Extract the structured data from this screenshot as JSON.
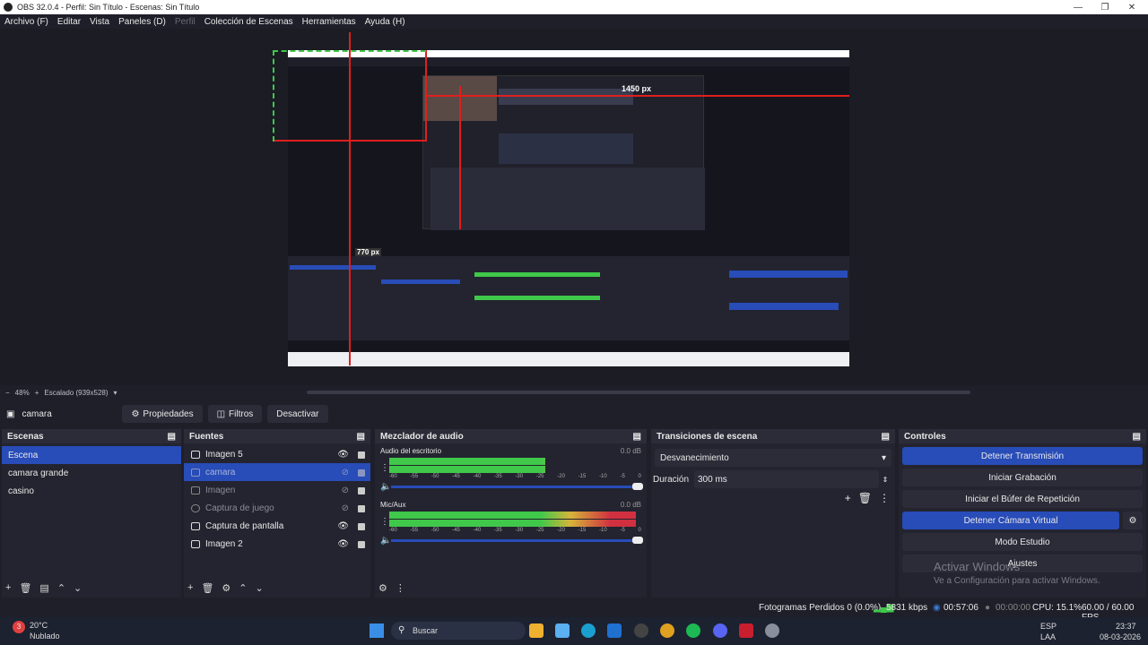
{
  "window": {
    "title": "OBS 32.0.4 - Perfil: Sin Título - Escenas: Sin Título"
  },
  "menu": [
    {
      "label": "Archivo (F)",
      "dim": false
    },
    {
      "label": "Editar",
      "dim": false
    },
    {
      "label": "Vista",
      "dim": false
    },
    {
      "label": "Paneles (D)",
      "dim": false
    },
    {
      "label": "Perfil",
      "dim": true
    },
    {
      "label": "Colección de Escenas",
      "dim": false
    },
    {
      "label": "Herramientas",
      "dim": false
    },
    {
      "label": "Ayuda (H)",
      "dim": false
    }
  ],
  "preview": {
    "px_top": "1450 px",
    "px_left": "770 px",
    "zoom": "48%",
    "scale_label": "Escalado (939x528)"
  },
  "source_bar": {
    "current": "camara",
    "properties": "Propiedades",
    "filters": "Filtros",
    "disable": "Desactivar"
  },
  "scenes": {
    "title": "Escenas",
    "items": [
      "Escena",
      "camara grande",
      "casino"
    ],
    "selected": 0
  },
  "sources": {
    "title": "Fuentes",
    "items": [
      {
        "label": "Imagen 5",
        "visible": true,
        "dim": false,
        "icon": "image-icon"
      },
      {
        "label": "camara",
        "visible": false,
        "dim": true,
        "icon": "camera-icon"
      },
      {
        "label": "Imagen",
        "visible": false,
        "dim": true,
        "icon": "image-icon"
      },
      {
        "label": "Captura de juego",
        "visible": false,
        "dim": true,
        "icon": "gamepad-icon"
      },
      {
        "label": "Captura de pantalla",
        "visible": true,
        "dim": false,
        "icon": "monitor-icon"
      },
      {
        "label": "Imagen 2",
        "visible": true,
        "dim": false,
        "icon": "image-icon"
      }
    ],
    "selected": 1
  },
  "mixer": {
    "title": "Mezclador de audio",
    "channels": [
      {
        "name": "Audio del escritorio",
        "db": "0.0 dB",
        "level": 0.62
      },
      {
        "name": "Mic/Aux",
        "db": "0.0 dB",
        "level": 0.98
      }
    ],
    "ticks": [
      "-60",
      "-55",
      "-50",
      "-45",
      "-40",
      "-35",
      "-30",
      "-25",
      "-20",
      "-15",
      "-10",
      "-5",
      "0"
    ]
  },
  "transitions": {
    "title": "Transiciones de escena",
    "selected": "Desvanecimiento",
    "duration_label": "Duración",
    "duration_value": "300 ms"
  },
  "controls": {
    "title": "Controles",
    "buttons": [
      {
        "label": "Detener Transmisión",
        "active": true
      },
      {
        "label": "Iniciar Grabación",
        "active": false
      },
      {
        "label": "Iniciar el Búfer de Repetición",
        "active": false
      },
      {
        "label": "Detener Cámara Virtual",
        "active": true
      },
      {
        "label": "Modo Estudio",
        "active": false
      },
      {
        "label": "Ajustes",
        "active": false
      }
    ],
    "watermark_title": "Activar Windows",
    "watermark_sub": "Ve a Configuración para activar Windows."
  },
  "status": {
    "dropped": "Fotogramas Perdidos 0 (0.0%)",
    "bitrate": "5831 kbps",
    "stream_time": "00:57:06",
    "rec_time": "00:00:00",
    "cpu": "CPU: 15.1%",
    "fps": "60.00 / 60.00 FPS"
  },
  "taskbar": {
    "weather_temp": "20°C",
    "weather_desc": "Nublado",
    "weather_badge": "3",
    "search": "Buscar",
    "lang": "ESP",
    "lang2": "LAA",
    "time": "23:37",
    "date": "08-03-2026"
  },
  "colors": {
    "accent": "#284cb8",
    "red_guide": "#e01e1e",
    "meter_green": "#3fc84a",
    "meter_yellow": "#d6b43a",
    "meter_red": "#d03040"
  }
}
